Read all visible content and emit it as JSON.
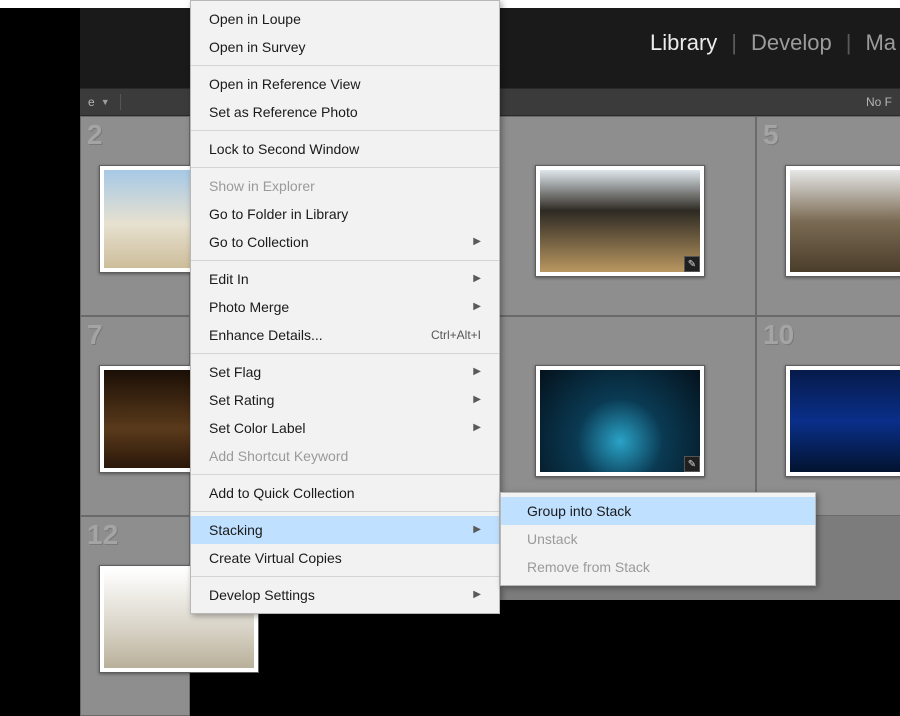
{
  "header": {
    "modules": [
      "Library",
      "Develop",
      "Ma"
    ],
    "active_index": 0
  },
  "toolbar": {
    "left_label": "e",
    "right_label": "No F"
  },
  "grid": {
    "row1": {
      "first_visible_index": "2",
      "mid_index": "",
      "right_index": "5"
    },
    "row2": {
      "left_index": "7",
      "right_index": "10"
    },
    "row3": {
      "left_index": "12"
    }
  },
  "context_menu": {
    "items": [
      {
        "label": "Open in Loupe",
        "type": "item"
      },
      {
        "label": "Open in Survey",
        "type": "item"
      },
      {
        "type": "sep"
      },
      {
        "label": "Open in Reference View",
        "type": "item"
      },
      {
        "label": "Set as Reference Photo",
        "type": "item"
      },
      {
        "type": "sep"
      },
      {
        "label": "Lock to Second Window",
        "type": "item"
      },
      {
        "type": "sep"
      },
      {
        "label": "Show in Explorer",
        "type": "item",
        "disabled": true
      },
      {
        "label": "Go to Folder in Library",
        "type": "item"
      },
      {
        "label": "Go to Collection",
        "type": "item",
        "submenu": true
      },
      {
        "type": "sep"
      },
      {
        "label": "Edit In",
        "type": "item",
        "submenu": true
      },
      {
        "label": "Photo Merge",
        "type": "item",
        "submenu": true
      },
      {
        "label": "Enhance Details...",
        "type": "item",
        "shortcut": "Ctrl+Alt+I"
      },
      {
        "type": "sep"
      },
      {
        "label": "Set Flag",
        "type": "item",
        "submenu": true
      },
      {
        "label": "Set Rating",
        "type": "item",
        "submenu": true
      },
      {
        "label": "Set Color Label",
        "type": "item",
        "submenu": true
      },
      {
        "label": "Add Shortcut Keyword",
        "type": "item",
        "disabled": true
      },
      {
        "type": "sep"
      },
      {
        "label": "Add to Quick Collection",
        "type": "item"
      },
      {
        "type": "sep"
      },
      {
        "label": "Stacking",
        "type": "item",
        "submenu": true,
        "highlight": true
      },
      {
        "label": "Create Virtual Copies",
        "type": "item"
      },
      {
        "type": "sep"
      },
      {
        "label": "Develop Settings",
        "type": "item",
        "submenu": true
      }
    ]
  },
  "stacking_submenu": {
    "items": [
      {
        "label": "Group into Stack",
        "highlight": true
      },
      {
        "label": "Unstack",
        "disabled": true
      },
      {
        "label": "Remove from Stack",
        "disabled": true
      }
    ]
  },
  "icons": {
    "edit_badge": "✎"
  }
}
